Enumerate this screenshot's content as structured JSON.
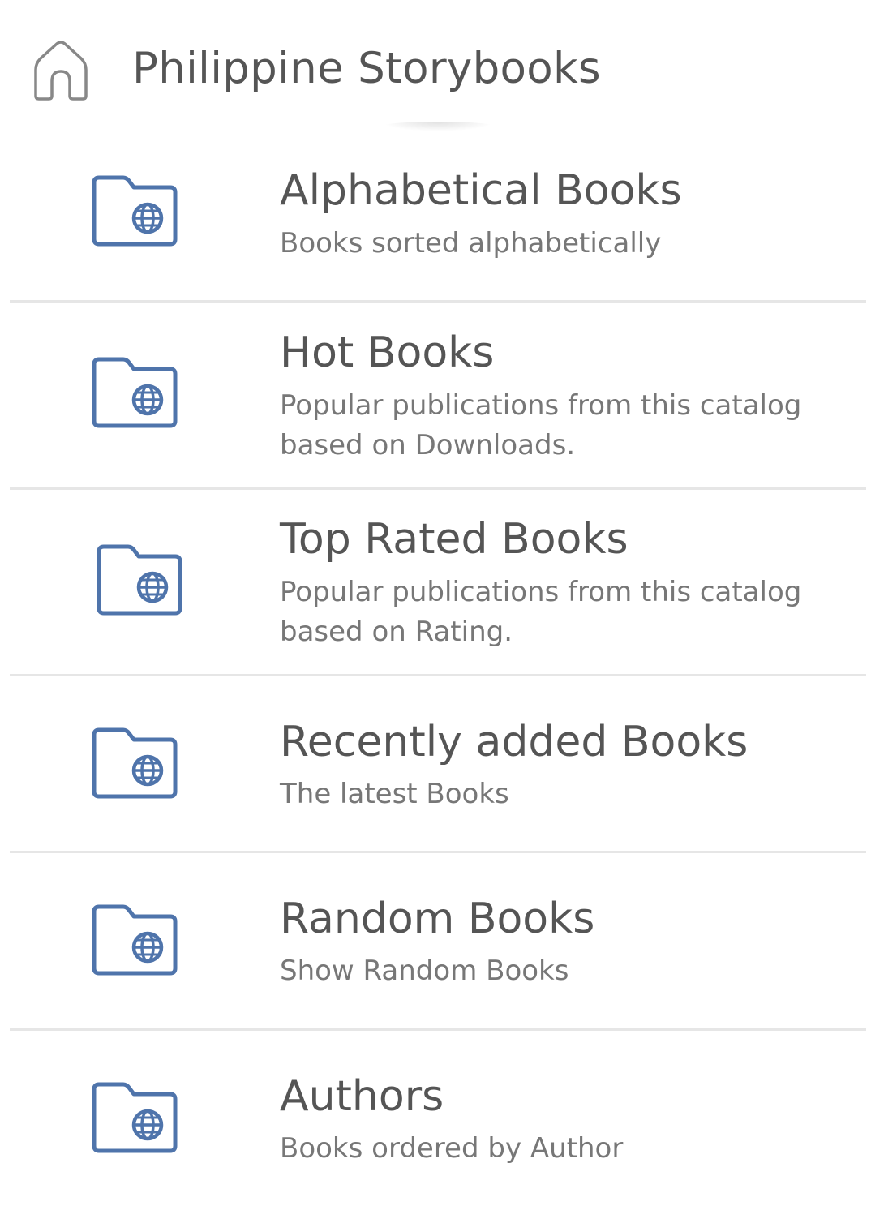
{
  "header": {
    "title": "Philippine Storybooks",
    "home_icon": "home-icon"
  },
  "colors": {
    "icon_accent": "#4f74ab",
    "title_text": "#555555",
    "description_text": "#777777",
    "divider": "#e6e6e6"
  },
  "catalog": {
    "items": [
      {
        "title": "Alphabetical Books",
        "description": "Books sorted alphabetically",
        "icon": "folder-globe-icon"
      },
      {
        "title": "Hot Books",
        "description": "Popular publications from this catalog based on Downloads.",
        "icon": "folder-globe-icon"
      },
      {
        "title": "Top Rated Books",
        "description": "Popular publications from this catalog based on Rating.",
        "icon": "folder-globe-icon"
      },
      {
        "title": "Recently added Books",
        "description": "The latest Books",
        "icon": "folder-globe-icon"
      },
      {
        "title": "Random Books",
        "description": "Show Random Books",
        "icon": "folder-globe-icon"
      },
      {
        "title": "Authors",
        "description": "Books ordered by Author",
        "icon": "folder-globe-icon"
      }
    ]
  }
}
